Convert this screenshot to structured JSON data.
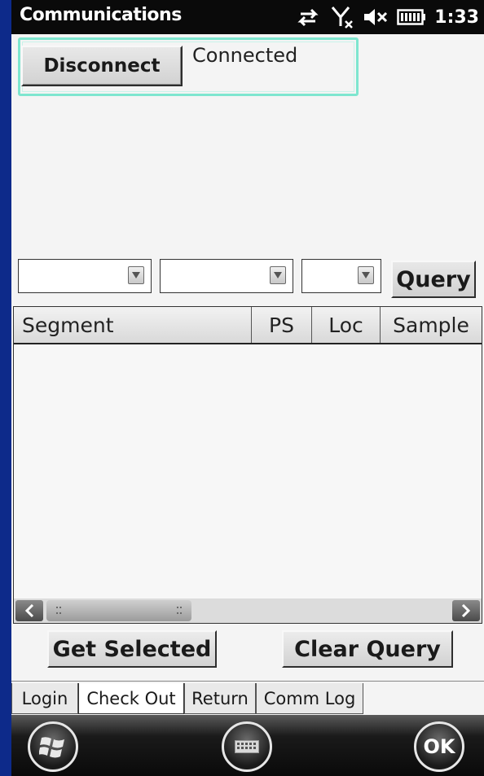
{
  "status_bar": {
    "title": "Communications",
    "time": "1:33"
  },
  "connection": {
    "disconnect_label": "Disconnect",
    "status_text": "Connected"
  },
  "query": {
    "combo1_value": "",
    "combo2_value": "",
    "combo3_value": "",
    "query_label": "Query"
  },
  "list": {
    "columns": [
      "Segment",
      "PS",
      "Loc",
      "Sample"
    ],
    "rows": []
  },
  "actions": {
    "get_selected_label": "Get Selected",
    "clear_query_label": "Clear Query"
  },
  "tabs": [
    "Login",
    "Check Out",
    "Return",
    "Comm Log"
  ],
  "active_tab": "Check Out",
  "softkeys": {
    "ok_label": "OK"
  },
  "colors": {
    "desktop_blue": "#0d2a8a",
    "highlight_teal": "#7ee6cf"
  }
}
